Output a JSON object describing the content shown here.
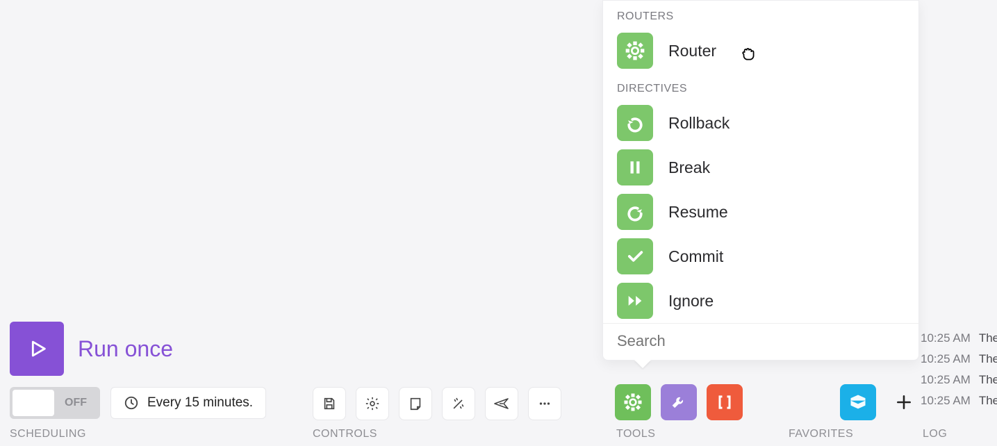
{
  "run": {
    "label": "Run once"
  },
  "schedule": {
    "toggle_state": "OFF",
    "freq": "Every 15 minutes."
  },
  "section_labels": {
    "scheduling": "SCHEDULING",
    "controls": "CONTROLS",
    "tools": "TOOLS",
    "favorites": "FAVORITES",
    "log": "LOG"
  },
  "popup": {
    "group_routers": "ROUTERS",
    "group_directives": "DIRECTIVES",
    "router": "Router",
    "rollback": "Rollback",
    "break": "Break",
    "resume": "Resume",
    "commit": "Commit",
    "ignore": "Ignore",
    "search_placeholder": "Search"
  },
  "log": {
    "t0": "10:25 AM",
    "m0": "The",
    "t1": "10:25 AM",
    "m1": "The",
    "t2": "10:25 AM",
    "m2": "The",
    "t3": "10:25 AM",
    "m3": "The"
  }
}
